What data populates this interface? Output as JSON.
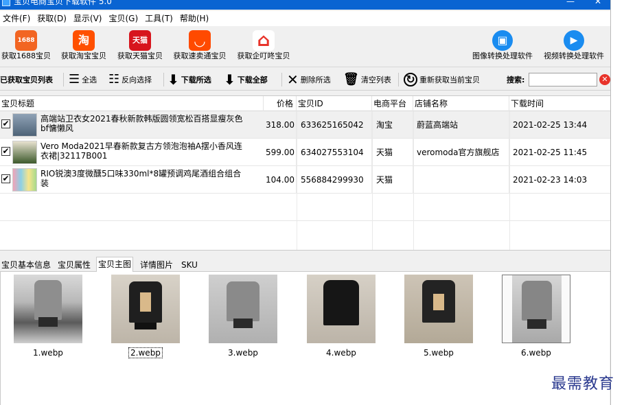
{
  "window": {
    "title": "宝贝电商宝贝下载软件 5.0",
    "min_glyph": "—",
    "close_glyph": "✕"
  },
  "menu": [
    "文件(F)",
    "获取(D)",
    "显示(V)",
    "宝贝(G)",
    "工具(T)",
    "帮助(H)"
  ],
  "big_toolbar": [
    {
      "label": "获取1688宝贝",
      "icon_text": "1688",
      "color": "#f26522"
    },
    {
      "label": "获取淘宝宝贝",
      "icon_text": "淘",
      "color": "#ff5000"
    },
    {
      "label": "获取天猫宝贝",
      "icon_text": "天猫",
      "color": "#d7151d"
    },
    {
      "label": "获取速卖通宝贝",
      "icon_text": "◡",
      "color": "#ff4a00"
    },
    {
      "label": "获取企叮咚宝贝",
      "icon_text": "⌂",
      "color": "#e8332a"
    },
    {
      "label": "图像转换处理软件",
      "icon_text": "▣",
      "color": "#1a8cf0"
    },
    {
      "label": "视频转换处理软件",
      "icon_text": "▶",
      "color": "#1a8cf0"
    }
  ],
  "action_toolbar": {
    "fetched_list": "已获取宝贝列表",
    "select_all": "全选",
    "invert": "反向选择",
    "download_selected": "下载所选",
    "download_all": "下载全部",
    "delete_selected": "删除所选",
    "clear_list": "清空列表",
    "refetch": "重新获取当前宝贝",
    "search_label": "搜索:"
  },
  "table": {
    "columns": [
      "宝贝标题",
      "价格",
      "宝贝ID",
      "电商平台",
      "店铺名称",
      "下载时间"
    ],
    "rows": [
      {
        "checked": "✔",
        "title": "高端站卫衣女2021春秋新款韩版圆领宽松百搭显瘦灰色bf慵懒风",
        "price": "318.00",
        "id": "633625165042",
        "platform": "淘宝",
        "shop": "蔚蓝高端站",
        "time": "2021-02-25 13:44",
        "thumb_color": "#6a7f96"
      },
      {
        "checked": "✔",
        "title": "Vero Moda2021早春新款复古方领泡泡袖A摆小香风连衣裙|32117B001",
        "price": "599.00",
        "id": "634027553104",
        "platform": "天猫",
        "shop": "veromoda官方旗舰店",
        "time": "2021-02-25 11:45",
        "thumb_color": "#3d5a2c"
      },
      {
        "checked": "✔",
        "title": "RIO锐澳3度微醺5口味330ml*8罐预调鸡尾酒组合组合装",
        "price": "104.00",
        "id": "556884299930",
        "platform": "天猫",
        "shop": "",
        "time": "2021-02-23 14:03",
        "thumb_color": "#7fc0d8"
      }
    ]
  },
  "tabs": [
    "宝贝基本信息",
    "宝贝属性",
    "宝贝主图",
    "详情图片",
    "SKU"
  ],
  "active_tab": "宝贝主图",
  "images": [
    {
      "name": "1.webp",
      "tone": "#a9a9a9",
      "top": "#8c8c8c"
    },
    {
      "name": "2.webp",
      "tone": "#2a2a2a",
      "top": "#222222"
    },
    {
      "name": "3.webp",
      "tone": "#a5a5a5",
      "top": "#8a8a8a"
    },
    {
      "name": "4.webp",
      "tone": "#1f1f1f",
      "top": "#1a1a1a"
    },
    {
      "name": "5.webp",
      "tone": "#2c2c2c",
      "top": "#232323"
    },
    {
      "name": "6.webp",
      "tone": "#9a9a9a",
      "top": "#828282"
    }
  ],
  "watermark": "最需教育"
}
